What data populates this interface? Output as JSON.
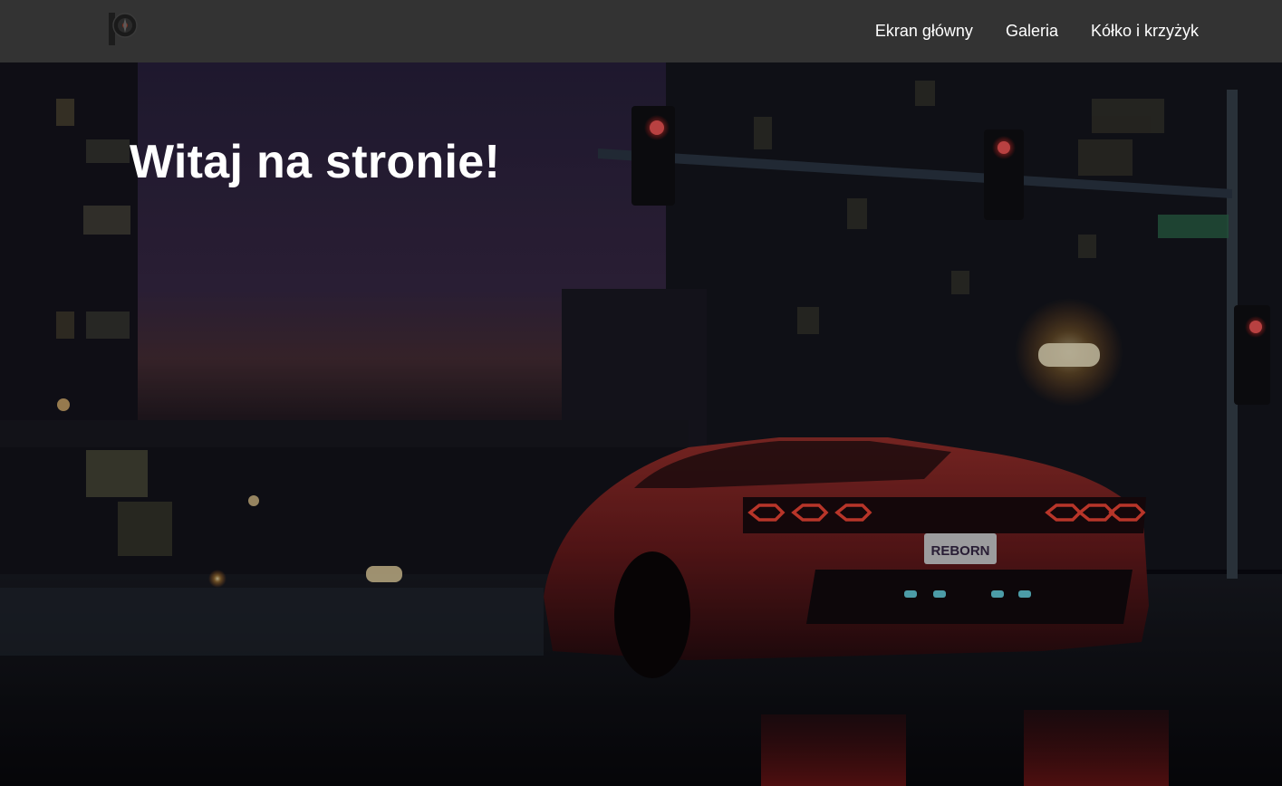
{
  "navbar": {
    "logo_icon": "p-letter-logo-icon",
    "links": [
      {
        "label": "Ekran główny"
      },
      {
        "label": "Galeria"
      },
      {
        "label": "Kółko i krzyżyk"
      }
    ]
  },
  "hero": {
    "title": "Witaj na stronie!",
    "background_image": "night-city-red-sports-car",
    "license_plate": "REBORN"
  },
  "colors": {
    "navbar_bg": "#333333",
    "text": "#ffffff",
    "car": "#8a1f22",
    "taillight": "#ff4a3a"
  }
}
